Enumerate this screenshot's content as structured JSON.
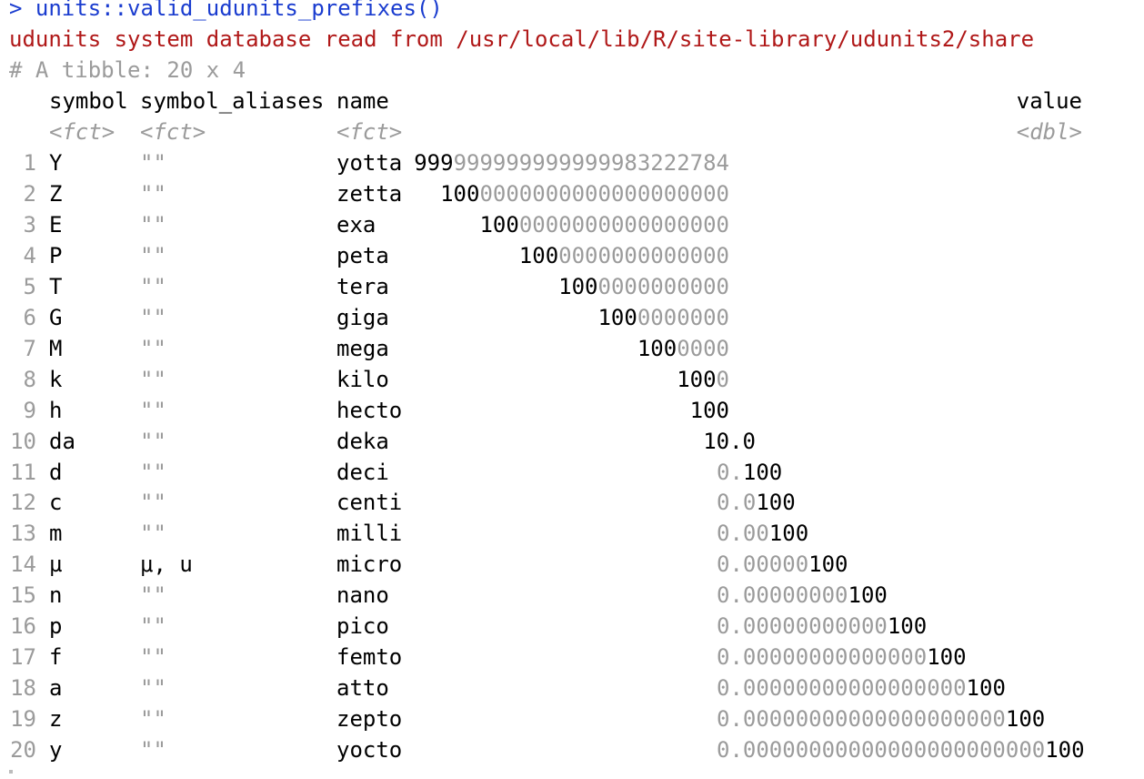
{
  "console": {
    "command": "> units::valid_udunits_prefixes()",
    "message": "udunits system database read from /usr/local/lib/R/site-library/udunits2/share",
    "tibble_info": "# A tibble: 20 x 4"
  },
  "table": {
    "columns": [
      {
        "key": "symbol",
        "header": "symbol",
        "type": "<fct>"
      },
      {
        "key": "symbol_aliases",
        "header": "symbol_aliases",
        "type": "<fct>"
      },
      {
        "key": "name",
        "header": "name",
        "type": "<fct>"
      },
      {
        "key": "value",
        "header": "value",
        "type": "<dbl>"
      }
    ],
    "rows": [
      {
        "idx": "1",
        "symbol": "Y",
        "alias": "\"\"",
        "name": "yotta",
        "value_bold": "999",
        "value_dim": "999999999999983222784",
        "value_tail": ""
      },
      {
        "idx": "2",
        "symbol": "Z",
        "alias": "\"\"",
        "name": "zetta",
        "value_bold": "100",
        "value_dim": "0000000000000000000",
        "value_tail": ""
      },
      {
        "idx": "3",
        "symbol": "E",
        "alias": "\"\"",
        "name": "exa",
        "value_bold": "100",
        "value_dim": "0000000000000000",
        "value_tail": ""
      },
      {
        "idx": "4",
        "symbol": "P",
        "alias": "\"\"",
        "name": "peta",
        "value_bold": "100",
        "value_dim": "0000000000000",
        "value_tail": ""
      },
      {
        "idx": "5",
        "symbol": "T",
        "alias": "\"\"",
        "name": "tera",
        "value_bold": "100",
        "value_dim": "0000000000",
        "value_tail": ""
      },
      {
        "idx": "6",
        "symbol": "G",
        "alias": "\"\"",
        "name": "giga",
        "value_bold": "100",
        "value_dim": "0000000",
        "value_tail": ""
      },
      {
        "idx": "7",
        "symbol": "M",
        "alias": "\"\"",
        "name": "mega",
        "value_bold": "100",
        "value_dim": "0000",
        "value_tail": ""
      },
      {
        "idx": "8",
        "symbol": "k",
        "alias": "\"\"",
        "name": "kilo",
        "value_bold": "100",
        "value_dim": "0",
        "value_tail": ""
      },
      {
        "idx": "9",
        "symbol": "h",
        "alias": "\"\"",
        "name": "hecto",
        "value_bold": "100",
        "value_dim": "",
        "value_tail": ""
      },
      {
        "idx": "10",
        "symbol": "da",
        "alias": "\"\"",
        "name": "deka",
        "value_bold": "10.0",
        "value_dim": "",
        "value_tail": ""
      },
      {
        "idx": "11",
        "symbol": "d",
        "alias": "\"\"",
        "name": "deci",
        "value_bold": "",
        "value_dim": "0.",
        "value_tail": "100"
      },
      {
        "idx": "12",
        "symbol": "c",
        "alias": "\"\"",
        "name": "centi",
        "value_bold": "",
        "value_dim": "0.0",
        "value_tail": "100"
      },
      {
        "idx": "13",
        "symbol": "m",
        "alias": "\"\"",
        "name": "milli",
        "value_bold": "",
        "value_dim": "0.00",
        "value_tail": "100"
      },
      {
        "idx": "14",
        "symbol": "µ",
        "alias": "μ, u",
        "name": "micro",
        "value_bold": "",
        "value_dim": "0.00000",
        "value_tail": "100"
      },
      {
        "idx": "15",
        "symbol": "n",
        "alias": "\"\"",
        "name": "nano",
        "value_bold": "",
        "value_dim": "0.00000000",
        "value_tail": "100"
      },
      {
        "idx": "16",
        "symbol": "p",
        "alias": "\"\"",
        "name": "pico",
        "value_bold": "",
        "value_dim": "0.00000000000",
        "value_tail": "100"
      },
      {
        "idx": "17",
        "symbol": "f",
        "alias": "\"\"",
        "name": "femto",
        "value_bold": "",
        "value_dim": "0.00000000000000",
        "value_tail": "100"
      },
      {
        "idx": "18",
        "symbol": "a",
        "alias": "\"\"",
        "name": "atto",
        "value_bold": "",
        "value_dim": "0.00000000000000000",
        "value_tail": "100"
      },
      {
        "idx": "19",
        "symbol": "z",
        "alias": "\"\"",
        "name": "zepto",
        "value_bold": "",
        "value_dim": "0.00000000000000000000",
        "value_tail": "100"
      },
      {
        "idx": "20",
        "symbol": "y",
        "alias": "\"\"",
        "name": "yocto",
        "value_bold": "",
        "value_dim": "0.00000000000000000000000",
        "value_tail": "100"
      }
    ]
  },
  "colors": {
    "command": "#1a3ccf",
    "message": "#b01818",
    "dim": "#9b9b9b",
    "text": "#000000",
    "background": "#ffffff"
  }
}
